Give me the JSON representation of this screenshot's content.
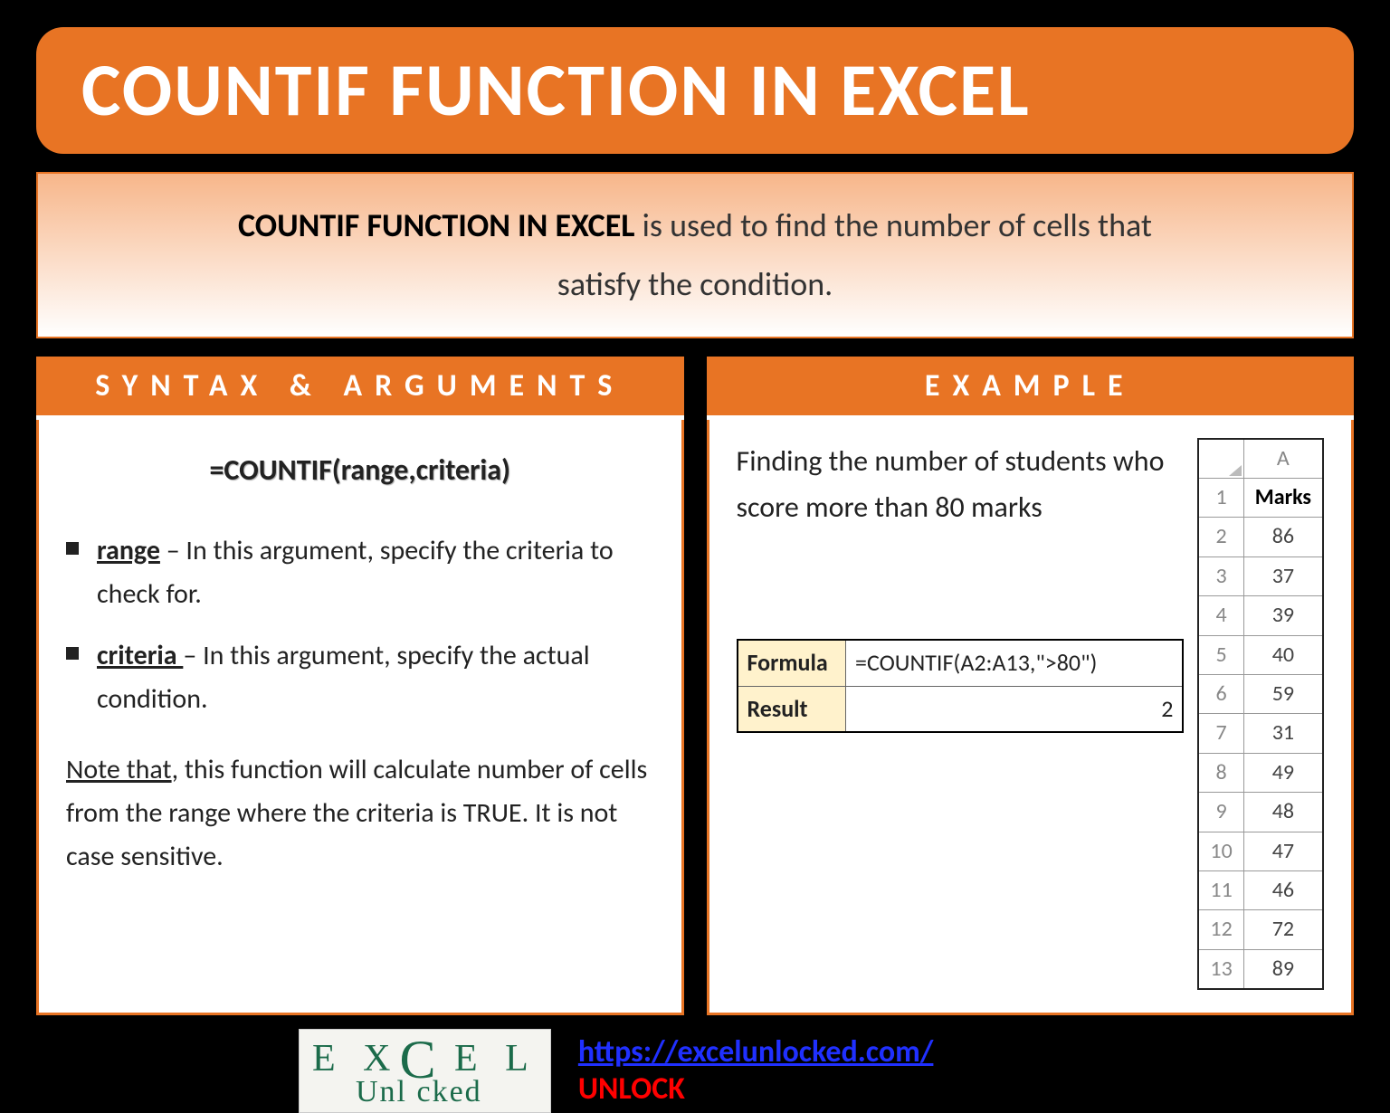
{
  "title": "COUNTIF FUNCTION IN EXCEL",
  "intro": {
    "strong": "COUNTIF FUNCTION IN EXCEL",
    "rest1": " is used to find the number of cells that",
    "rest2": "satisfy the condition."
  },
  "syntax": {
    "header": "SYNTAX & ARGUMENTS",
    "formula": "=COUNTIF(range,criteria)",
    "args": [
      {
        "name": "range",
        "desc": " – In this argument, specify the criteria to check for."
      },
      {
        "name": "criteria ",
        "desc": "– In this argument, specify the actual condition."
      }
    ],
    "note_u": "Note that",
    "note_rest": ", this function will calculate number of cells from the range where the criteria is TRUE. It is not case sensitive."
  },
  "example": {
    "header": "EXAMPLE",
    "desc": "Finding the number of students who score more than 80 marks",
    "formula_label": "Formula",
    "formula_value": "=COUNTIF(A2:A13,\">80\")",
    "result_label": "Result",
    "result_value": "2",
    "col_letter": "A",
    "marks_header": "Marks",
    "marks": [
      "86",
      "37",
      "39",
      "40",
      "59",
      "31",
      "49",
      "48",
      "47",
      "46",
      "72",
      "89"
    ],
    "rows": [
      "1",
      "2",
      "3",
      "4",
      "5",
      "6",
      "7",
      "8",
      "9",
      "10",
      "11",
      "12",
      "13"
    ]
  },
  "footer": {
    "logo_top": "EX  EL",
    "logo_c": "C",
    "logo_bot": "Unl   cked",
    "url": "https://excelunlocked.com/",
    "unlock": "UNLOCK"
  }
}
